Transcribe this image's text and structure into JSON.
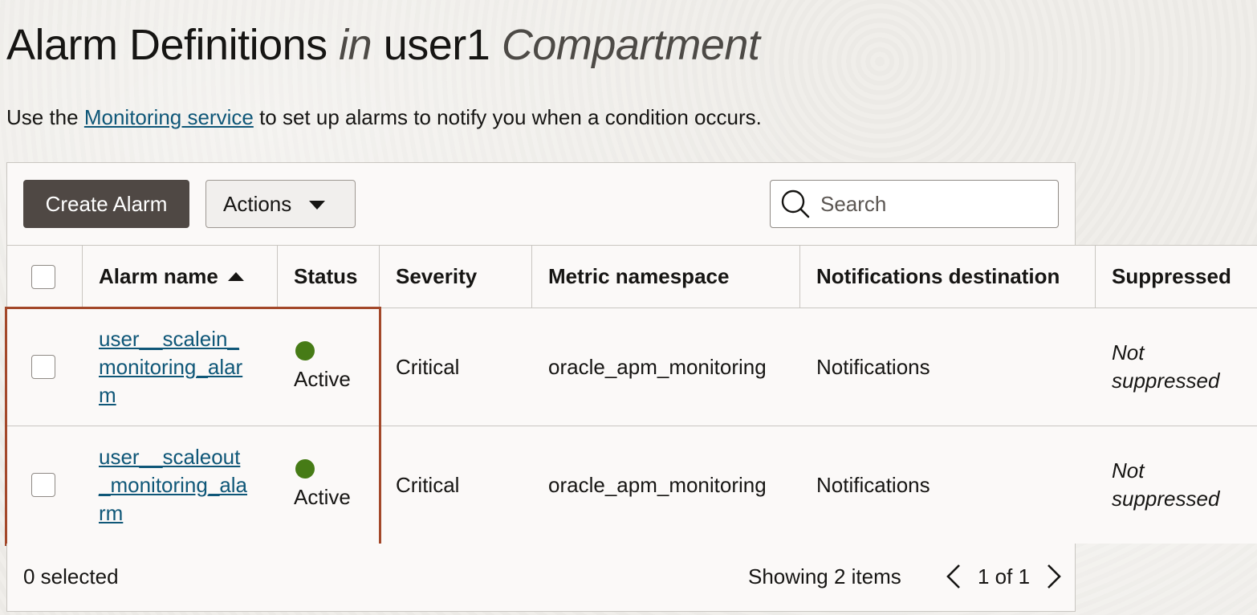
{
  "page": {
    "title_part1": "Alarm Definitions",
    "title_in": "in",
    "title_compartment": "user1",
    "title_suffix": "Compartment",
    "desc_prefix": "Use the",
    "desc_link": "Monitoring service",
    "desc_suffix": "to set up alarms to notify you when a condition occurs."
  },
  "toolbar": {
    "create_label": "Create Alarm",
    "actions_label": "Actions",
    "search_placeholder": "Search"
  },
  "table": {
    "columns": [
      "Alarm name",
      "Status",
      "Severity",
      "Metric namespace",
      "Notifications destination",
      "Suppressed"
    ],
    "rows": [
      {
        "name": "user_scalein_monitoring_alarm",
        "name_lines": [
          "user__scalein_",
          "monitoring_alar",
          "m"
        ],
        "status": "Active",
        "severity": "Critical",
        "namespace": "oracle_apm_monitoring",
        "destination": "Notifications",
        "suppressed_line1": "Not",
        "suppressed_line2": "suppressed"
      },
      {
        "name": "user_scaleout_monitoring_alarm",
        "name_lines": [
          "user__scaleout",
          "_monitoring_ala",
          "rm"
        ],
        "status": "Active",
        "severity": "Critical",
        "namespace": "oracle_apm_monitoring",
        "destination": "Notifications",
        "suppressed_line1": "Not",
        "suppressed_line2": "suppressed"
      }
    ]
  },
  "footer": {
    "selected": "0 selected",
    "showing": "Showing 2 items",
    "page": "1 of 1"
  },
  "colors": {
    "status_active": "#467b16",
    "link": "#0f5778",
    "primary_button": "#4f4844",
    "highlight_border": "#a3482a"
  }
}
